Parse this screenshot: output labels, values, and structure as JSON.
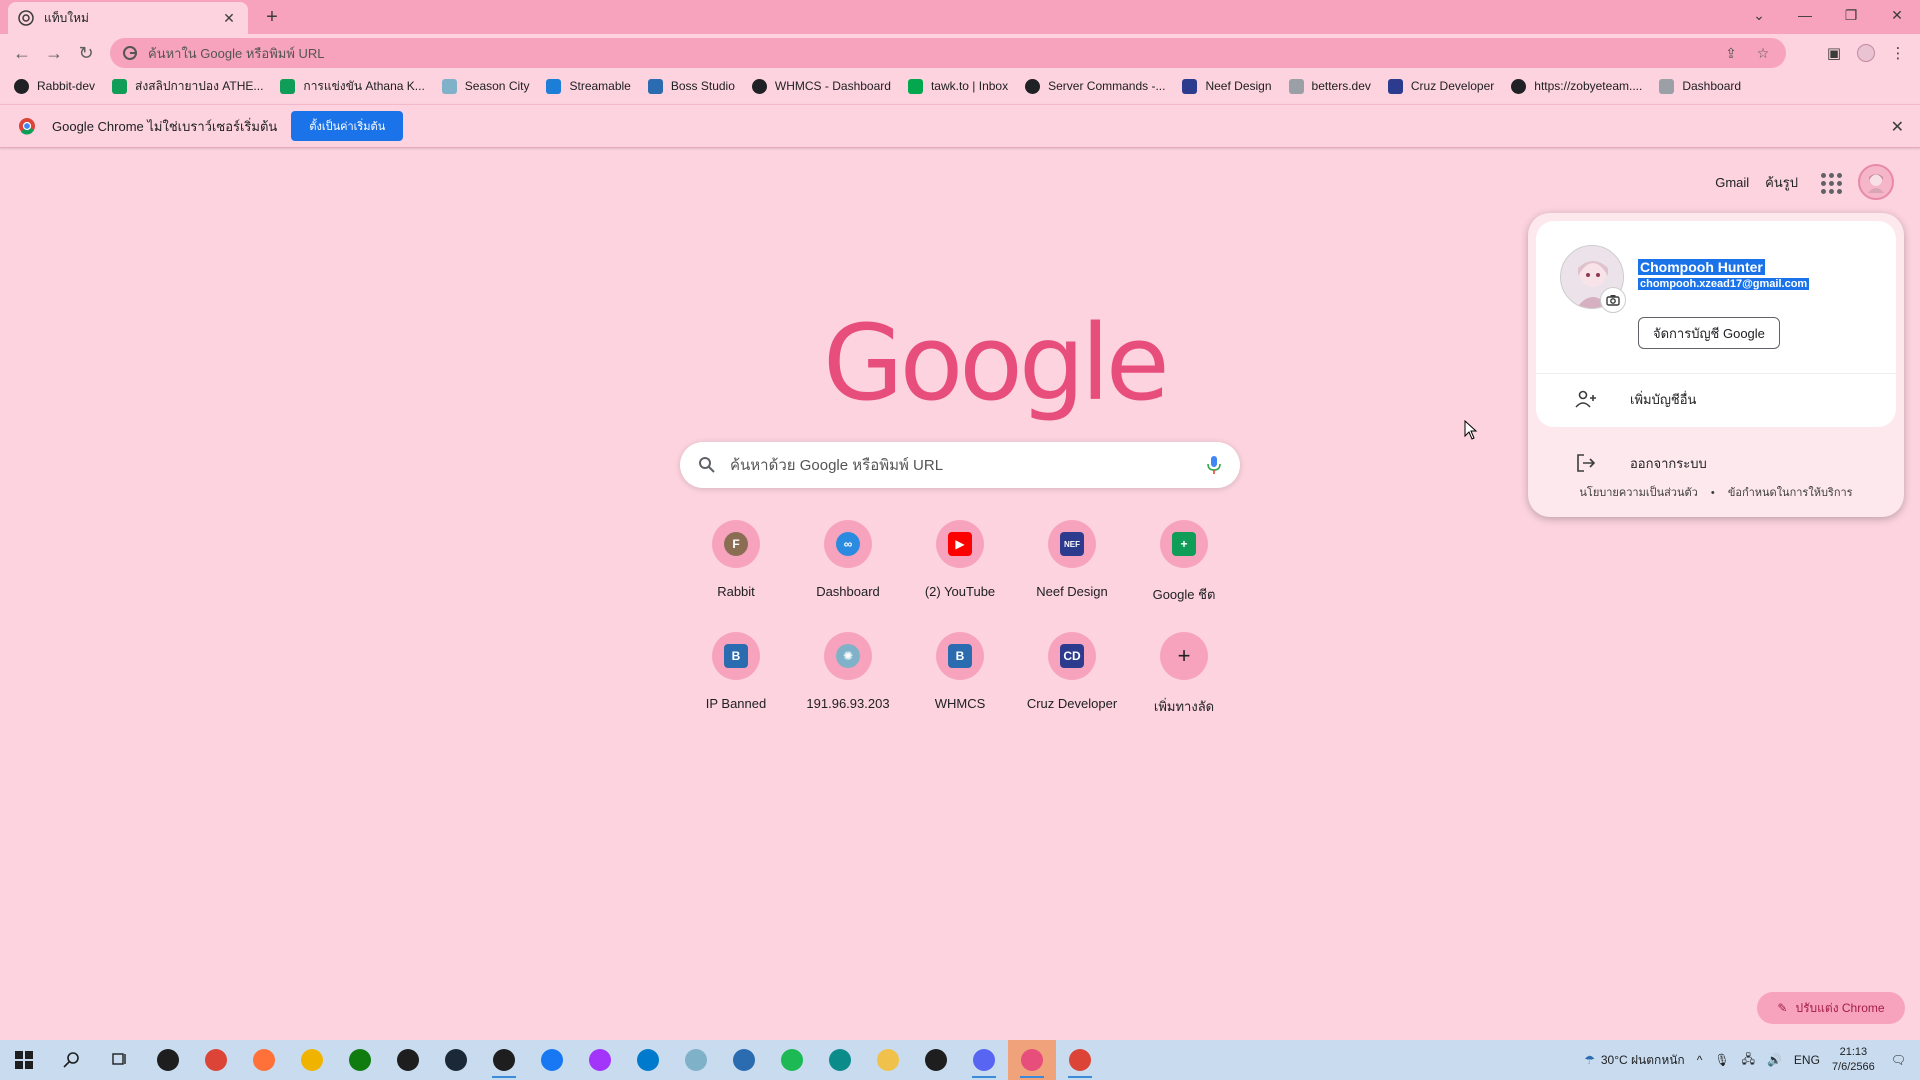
{
  "tab": {
    "title": "แท็บใหม่"
  },
  "omnibox": {
    "placeholder": "ค้นหาใน Google หรือพิมพ์ URL"
  },
  "bookmarks": [
    {
      "label": "Rabbit-dev",
      "icon": "globe-icon",
      "color": "#202124"
    },
    {
      "label": "ส่งสลิปกายาปอง ATHE...",
      "icon": "sheets-icon",
      "color": "#0f9d58"
    },
    {
      "label": "การแข่งขัน Athana K...",
      "icon": "sheets-icon",
      "color": "#0f9d58"
    },
    {
      "label": "Season City",
      "icon": "season-icon",
      "color": "#7fb2c9"
    },
    {
      "label": "Streamable",
      "icon": "streamable-icon",
      "color": "#1c7ed6"
    },
    {
      "label": "Boss Studio",
      "icon": "boss-icon",
      "color": "#2b6cb0"
    },
    {
      "label": "WHMCS - Dashboard",
      "icon": "globe-icon",
      "color": "#202124"
    },
    {
      "label": "tawk.to | Inbox",
      "icon": "tawk-icon",
      "color": "#03a84e"
    },
    {
      "label": "Server Commands -...",
      "icon": "globe-icon",
      "color": "#202124"
    },
    {
      "label": "Neef Design",
      "icon": "neef-icon",
      "color": "#2d3b8f"
    },
    {
      "label": "betters.dev",
      "icon": "betters-icon",
      "color": "#9aa0a6"
    },
    {
      "label": "Cruz Developer",
      "icon": "cruz-icon",
      "color": "#2d3b8f"
    },
    {
      "label": "https://zobyeteam....",
      "icon": "globe-icon",
      "color": "#202124"
    },
    {
      "label": "Dashboard",
      "icon": "betters-icon",
      "color": "#9aa0a6"
    }
  ],
  "infobar": {
    "message": "Google Chrome ไม่ใช่เบราว์เซอร์เริ่มต้น",
    "button": "ตั้งเป็นค่าเริ่มต้น"
  },
  "ntp": {
    "gmail": "Gmail",
    "images": "ค้นรูป",
    "logo": "Google",
    "search_placeholder": "ค้นหาด้วย Google หรือพิมพ์ URL",
    "customize": "ปรับแต่ง Chrome"
  },
  "shortcuts": [
    {
      "label": "Rabbit",
      "glyph": "F",
      "color": "#8a6d52"
    },
    {
      "label": "Dashboard",
      "glyph": "∞",
      "color": "#2b8be0"
    },
    {
      "label": "(2) YouTube",
      "glyph": "▶",
      "color": "#ff0000"
    },
    {
      "label": "Neef Design",
      "glyph": "NEF",
      "color": "#2d3b8f"
    },
    {
      "label": "Google ชีต",
      "glyph": "+",
      "color": "#0f9d58"
    },
    {
      "label": "IP Banned",
      "glyph": "B",
      "color": "#2b6cb0"
    },
    {
      "label": "191.96.93.203",
      "glyph": "✺",
      "color": "#7fb2c9"
    },
    {
      "label": "WHMCS",
      "glyph": "B",
      "color": "#2b6cb0"
    },
    {
      "label": "Cruz Developer",
      "glyph": "CD",
      "color": "#2d3b8f"
    },
    {
      "label": "เพิ่มทางลัด",
      "glyph": "+",
      "color": "transparent"
    }
  ],
  "account": {
    "name": "Chompooh Hunter",
    "email": "chompooh.xzead17@gmail.com",
    "manage": "จัดการบัญชี Google",
    "add_account": "เพิ่มบัญชีอื่น",
    "sign_out": "ออกจากระบบ",
    "privacy": "นโยบายความเป็นส่วนตัว",
    "separator": "•",
    "terms": "ข้อกำหนดในการให้บริการ"
  },
  "taskbar": {
    "weather": "30°C ฝนตกหนัก",
    "language": "ENG",
    "time": "21:13",
    "date": "7/6/2566"
  }
}
